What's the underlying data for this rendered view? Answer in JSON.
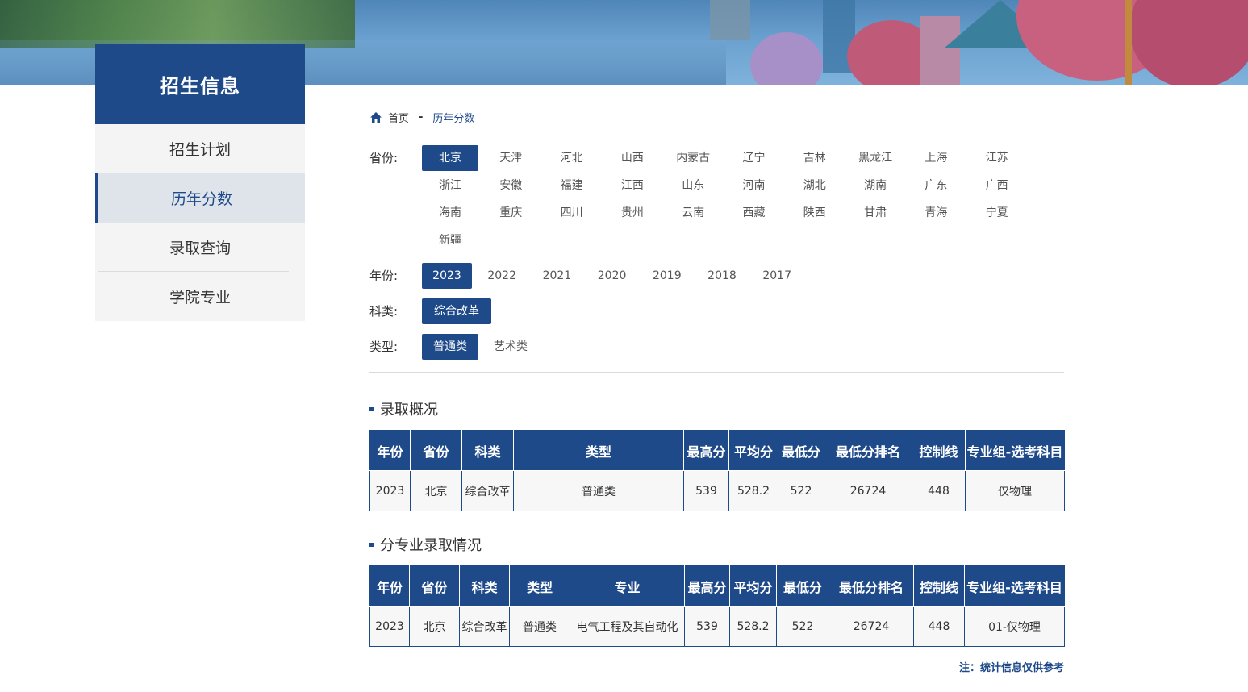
{
  "sidebar": {
    "title": "招生信息",
    "items": [
      {
        "label": "招生计划"
      },
      {
        "label": "历年分数"
      },
      {
        "label": "录取查询"
      },
      {
        "label": "学院专业"
      }
    ]
  },
  "breadcrumb": {
    "home": "首页",
    "sep": "-",
    "current": "历年分数"
  },
  "filters": {
    "province_label": "省份:",
    "provinces": [
      "北京",
      "天津",
      "河北",
      "山西",
      "内蒙古",
      "辽宁",
      "吉林",
      "黑龙江",
      "上海",
      "江苏",
      "浙江",
      "安徽",
      "福建",
      "江西",
      "山东",
      "河南",
      "湖北",
      "湖南",
      "广东",
      "广西",
      "海南",
      "重庆",
      "四川",
      "贵州",
      "云南",
      "西藏",
      "陕西",
      "甘肃",
      "青海",
      "宁夏",
      "新疆"
    ],
    "province_selected": "北京",
    "year_label": "年份:",
    "years": [
      "2023",
      "2022",
      "2021",
      "2020",
      "2019",
      "2018",
      "2017"
    ],
    "year_selected": "2023",
    "category_label": "科类:",
    "categories": [
      "综合改革"
    ],
    "category_selected": "综合改革",
    "type_label": "类型:",
    "types": [
      "普通类",
      "艺术类"
    ],
    "type_selected": "普通类"
  },
  "overview": {
    "title": "录取概况",
    "headers": [
      "年份",
      "省份",
      "科类",
      "类型",
      "最高分",
      "平均分",
      "最低分",
      "最低分排名",
      "控制线",
      "专业组-选考科目"
    ],
    "rows": [
      [
        "2023",
        "北京",
        "综合改革",
        "普通类",
        "539",
        "528.2",
        "522",
        "26724",
        "448",
        "仅物理"
      ]
    ]
  },
  "by_major": {
    "title": "分专业录取情况",
    "headers": [
      "年份",
      "省份",
      "科类",
      "类型",
      "专业",
      "最高分",
      "平均分",
      "最低分",
      "最低分排名",
      "控制线",
      "专业组-选考科目"
    ],
    "rows": [
      [
        "2023",
        "北京",
        "综合改革",
        "普通类",
        "电气工程及其自动化",
        "539",
        "528.2",
        "522",
        "26724",
        "448",
        "01-仅物理"
      ]
    ]
  },
  "note": "注：统计信息仅供参考",
  "colors": {
    "primary": "#1f4a8a",
    "sidebar_bg": "#f4f4f4",
    "active_bg": "#dfe3ea"
  }
}
